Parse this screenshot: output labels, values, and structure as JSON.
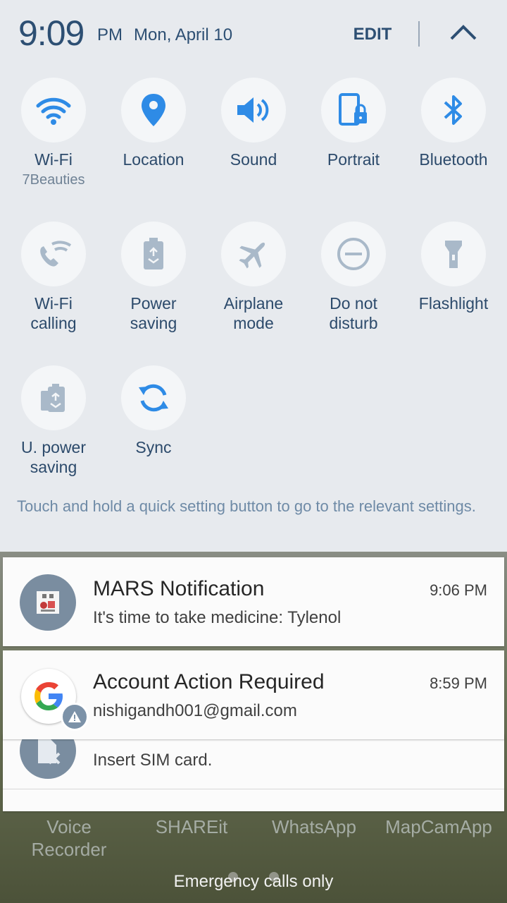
{
  "status": {
    "time": "9:09",
    "ampm": "PM",
    "date": "Mon, April 10"
  },
  "header": {
    "edit_label": "EDIT"
  },
  "quick_settings": {
    "tiles": [
      {
        "label": "Wi-Fi",
        "sub": "7Beauties",
        "icon": "wifi-icon"
      },
      {
        "label": "Location",
        "icon": "location-icon"
      },
      {
        "label": "Sound",
        "icon": "sound-icon"
      },
      {
        "label": "Portrait",
        "icon": "portrait-lock-icon"
      },
      {
        "label": "Bluetooth",
        "icon": "bluetooth-icon"
      },
      {
        "label": "Wi-Fi\ncalling",
        "icon": "wifi-calling-icon"
      },
      {
        "label": "Power\nsaving",
        "icon": "power-saving-icon"
      },
      {
        "label": "Airplane\nmode",
        "icon": "airplane-icon"
      },
      {
        "label": "Do not\ndisturb",
        "icon": "do-not-disturb-icon"
      },
      {
        "label": "Flashlight",
        "icon": "flashlight-icon"
      },
      {
        "label": "U. power\nsaving",
        "icon": "ultra-power-saving-icon"
      },
      {
        "label": "Sync",
        "icon": "sync-icon"
      }
    ],
    "hint": "Touch and hold a quick setting button to go to the relevant settings."
  },
  "notifications": [
    {
      "title": "MARS Notification",
      "body": "It's time to take medicine: Tylenol",
      "time": "9:06 PM"
    },
    {
      "title": "Account Action Required",
      "body": "nishigandh001@gmail.com",
      "time": "8:59 PM"
    },
    {
      "title": "",
      "body": "Insert SIM card.",
      "time": ""
    }
  ],
  "home_apps": [
    {
      "label": "Voice\nRecorder"
    },
    {
      "label": "SHAREit"
    },
    {
      "label": "WhatsApp"
    },
    {
      "label": "MapCamApp"
    }
  ],
  "footer": {
    "emergency": "Emergency calls only"
  },
  "colors": {
    "accent": "#2e8be6",
    "panel_bg": "#e7eaee",
    "text_primary": "#2c4a6b",
    "tile_circle": "#f4f6f8",
    "inactive_icon": "#a9b9c9"
  }
}
